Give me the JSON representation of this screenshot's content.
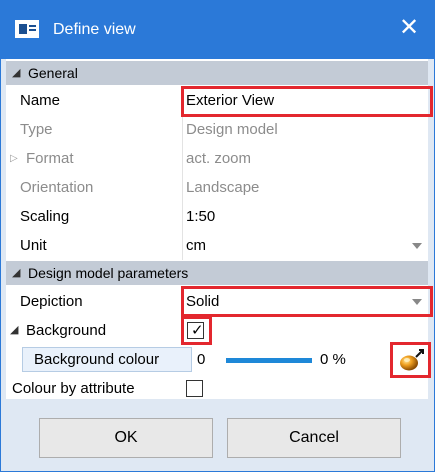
{
  "window": {
    "title": "Define view"
  },
  "sections": {
    "general": "General",
    "design_model": "Design model parameters"
  },
  "general_rows": [
    {
      "label": "Name",
      "value": "Exterior View"
    },
    {
      "label": "Type",
      "value": "Design model"
    },
    {
      "label": "Format",
      "value": "act. zoom"
    },
    {
      "label": "Orientation",
      "value": "Landscape"
    },
    {
      "label": "Scaling",
      "value": "1:50"
    },
    {
      "label": "Unit",
      "value": "cm"
    }
  ],
  "design_rows": {
    "depiction": {
      "label": "Depiction",
      "value": "Solid"
    },
    "background": {
      "label": "Background",
      "checked": true
    },
    "background_colour": {
      "label": "Background colour",
      "value": "0",
      "percent_text": "0 %"
    },
    "colour_by_attribute": {
      "label": "Colour by attribute",
      "checked": false
    }
  },
  "buttons": {
    "ok": "OK",
    "cancel": "Cancel"
  },
  "icons": {
    "title": "dialog-icon",
    "close": "close-icon",
    "expand": "expand-triangle-icon",
    "dropdown": "dropdown-arrow-icon",
    "color_picker": "color-picker-ball-icon"
  },
  "colors": {
    "titlebar": "#2b79d8",
    "highlight": "#e3272e",
    "progress": "#1e88d8"
  }
}
